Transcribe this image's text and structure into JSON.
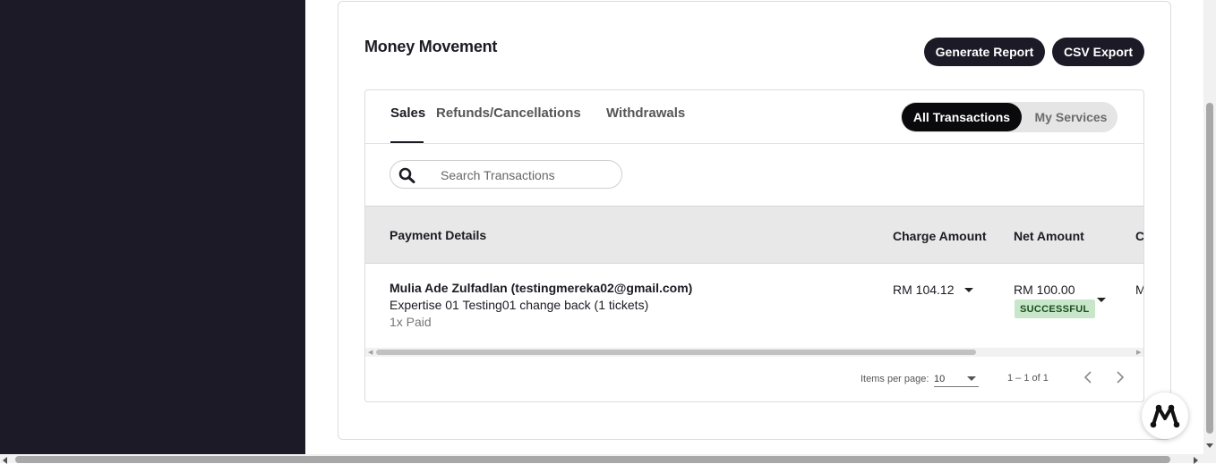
{
  "page": {
    "title": "Money Movement",
    "generate_report_label": "Generate Report",
    "csv_export_label": "CSV Export"
  },
  "tabs": [
    {
      "label": "Sales",
      "active": true
    },
    {
      "label": "Refunds/Cancellations",
      "active": false
    },
    {
      "label": "Withdrawals",
      "active": false
    }
  ],
  "filter_toggle": {
    "all_label": "All Transactions",
    "mine_label": "My Services",
    "selected": "All Transactions"
  },
  "search": {
    "placeholder": "Search Transactions",
    "value": ""
  },
  "table": {
    "headers": {
      "payment_details": "Payment Details",
      "charge_amount": "Charge Amount",
      "net_amount": "Net Amount",
      "next_col_cut": "C"
    },
    "rows": [
      {
        "payer": "Mulia Ade Zulfadlan (testingmereka02@gmail.com)",
        "event": "Expertise 01 Testing01 change back (1 tickets)",
        "payment_count": "1x Paid",
        "charge": "RM 104.12",
        "net": "RM 100.00",
        "status": "SUCCESSFUL",
        "next_col_cut": "M"
      }
    ]
  },
  "pagination": {
    "items_per_page_label": "Items per page:",
    "items_per_page_value": "10",
    "range_label": "1 – 1 of 1"
  },
  "colors": {
    "dark": "#1c1a27",
    "badge_bg": "#c8e6c9",
    "badge_text": "#1b4d1e",
    "header_bg": "#e8e8e8"
  },
  "icons": {
    "search": "magnifier-icon",
    "fab": "mereka-logo-icon"
  }
}
